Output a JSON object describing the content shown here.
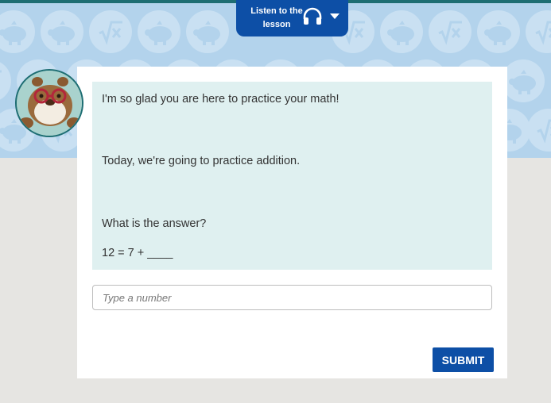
{
  "header": {
    "listen_line1": "Listen to the",
    "listen_line2": "lesson",
    "listen_icon": "headphones-icon",
    "dropdown_icon": "caret-down-icon"
  },
  "tutor": {
    "avatar_icon": "beaver-with-glasses"
  },
  "prompt": {
    "line1": "I'm so glad you are here to practice your math!",
    "line2": "Today, we're going to practice addition.",
    "line3": "What is the answer?",
    "equation": "12 = 7 + ____"
  },
  "answer": {
    "placeholder": "Type a number",
    "value": ""
  },
  "actions": {
    "submit_label": "SUBMIT"
  },
  "colors": {
    "accent": "#0d4fa6",
    "teal": "#1e6e73",
    "pattern_bg": "#b3d3ec",
    "prompt_bg": "#dff0f0",
    "page_bg": "#e6e5e2"
  }
}
